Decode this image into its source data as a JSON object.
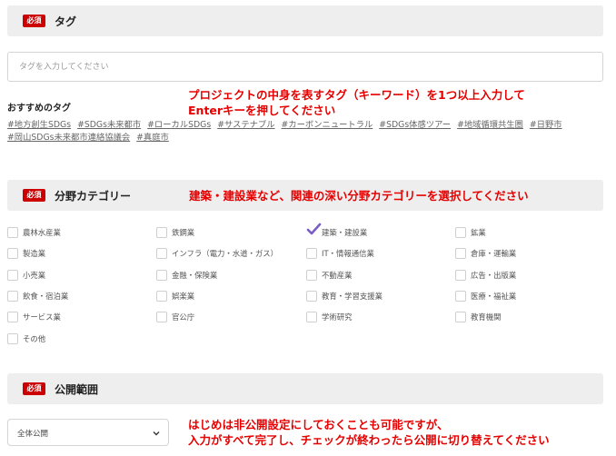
{
  "required_badge": "必須",
  "tags_section": {
    "title": "タグ",
    "input_placeholder": "タグを入力してください",
    "recommended_label": "おすすめのタグ",
    "annotation_line1": "プロジェクトの中身を表すタグ（キーワード）を1つ以上入力して",
    "annotation_line2": "Enterキーを押してください",
    "recommended_tags": [
      "#地方創生SDGs",
      "#SDGs未来都市",
      "#ローカルSDGs",
      "#サステナブル",
      "#カーボンニュートラル",
      "#SDGs体感ツアー",
      "#地域循環共生圏",
      "#日野市",
      "#岡山SDGs未来都市連絡協議会",
      "#真庭市"
    ]
  },
  "category_section": {
    "title": "分野カテゴリー",
    "annotation": "建築・建設業など、関連の深い分野カテゴリーを選択してください",
    "checked_color": "#7b5cc7",
    "options": [
      {
        "label": "農林水産業",
        "checked": false
      },
      {
        "label": "鉄鋼業",
        "checked": false
      },
      {
        "label": "建築・建設業",
        "checked": true
      },
      {
        "label": "鉱業",
        "checked": false
      },
      {
        "label": "製造業",
        "checked": false
      },
      {
        "label": "インフラ（電力・水道・ガス）",
        "checked": false
      },
      {
        "label": "IT・情報通信業",
        "checked": false
      },
      {
        "label": "倉庫・運輸業",
        "checked": false
      },
      {
        "label": "小売業",
        "checked": false
      },
      {
        "label": "金融・保険業",
        "checked": false
      },
      {
        "label": "不動産業",
        "checked": false
      },
      {
        "label": "広告・出版業",
        "checked": false
      },
      {
        "label": "飲食・宿泊業",
        "checked": false
      },
      {
        "label": "娯楽業",
        "checked": false
      },
      {
        "label": "教育・学習支援業",
        "checked": false
      },
      {
        "label": "医療・福祉業",
        "checked": false
      },
      {
        "label": "サービス業",
        "checked": false
      },
      {
        "label": "官公庁",
        "checked": false
      },
      {
        "label": "学術研究",
        "checked": false
      },
      {
        "label": "教育機関",
        "checked": false
      },
      {
        "label": "その他",
        "checked": false
      }
    ]
  },
  "visibility_section": {
    "title": "公開範囲",
    "selected_value": "全体公開",
    "icon": "chevron-down-icon",
    "annotation_line1": "はじめは非公開設定にしておくことも可能ですが、",
    "annotation_line2": "入力がすべて完了し、チェックが終わったら公開に切り替えてください"
  },
  "colors": {
    "badge": "#cc0000",
    "annotation": "#e60000",
    "header_bg": "#eeeeee"
  }
}
